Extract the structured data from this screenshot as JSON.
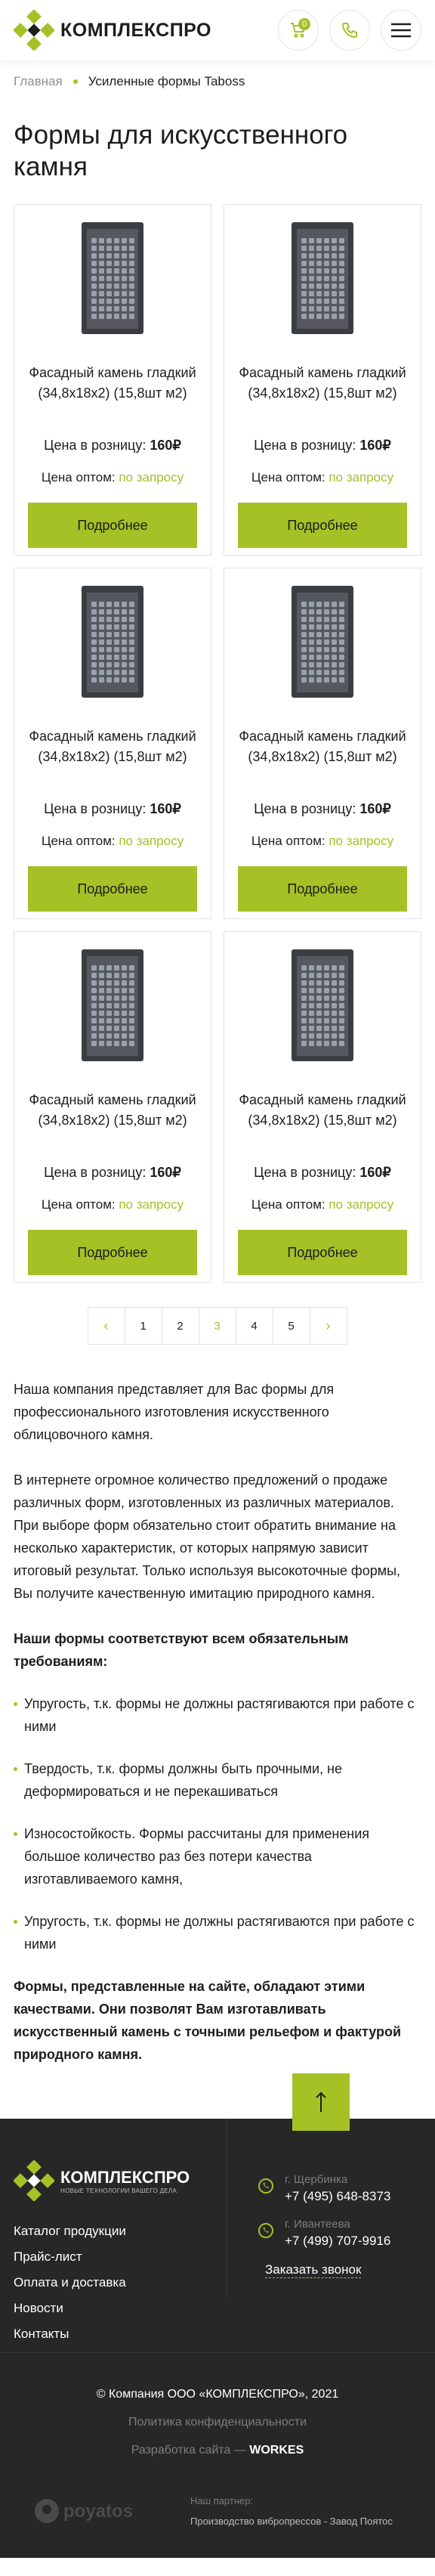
{
  "header": {
    "logo_text_a": "КОМПЛЕКС",
    "logo_text_b": "ПРО",
    "cart_count": "0",
    "icons": [
      "cart-icon",
      "phone-icon",
      "menu-icon"
    ]
  },
  "breadcrumbs": {
    "home": "Главная",
    "current": "Усиленные формы Taboss"
  },
  "page_title": "Формы для искусственного камня",
  "products": [
    {
      "name": "Фасадный камень гладкий (34,8х18х2) (15,8шт м2)",
      "retail_label": "Цена в розницу:",
      "retail_price": "160₽",
      "opt_label": "Цена оптом:",
      "opt_value": "по запросу",
      "button": "Подробнее"
    },
    {
      "name": "Фасадный камень гладкий (34,8х18х2) (15,8шт м2)",
      "retail_label": "Цена в розницу:",
      "retail_price": "160₽",
      "opt_label": "Цена оптом:",
      "opt_value": "по запросу",
      "button": "Подробнее"
    },
    {
      "name": "Фасадный камень гладкий (34,8х18х2) (15,8шт м2)",
      "retail_label": "Цена в розницу:",
      "retail_price": "160₽",
      "opt_label": "Цена оптом:",
      "opt_value": "по запросу",
      "button": "Подробнее"
    },
    {
      "name": "Фасадный камень гладкий (34,8х18х2) (15,8шт м2)",
      "retail_label": "Цена в розницу:",
      "retail_price": "160₽",
      "opt_label": "Цена оптом:",
      "opt_value": "по запросу",
      "button": "Подробнее"
    },
    {
      "name": "Фасадный камень гладкий (34,8х18х2) (15,8шт м2)",
      "retail_label": "Цена в розницу:",
      "retail_price": "160₽",
      "opt_label": "Цена оптом:",
      "opt_value": "по запросу",
      "button": "Подробнее"
    },
    {
      "name": "Фасадный камень гладкий (34,8х18х2) (15,8шт м2)",
      "retail_label": "Цена в розницу:",
      "retail_price": "160₽",
      "opt_label": "Цена оптом:",
      "opt_value": "по запросу",
      "button": "Подробнее"
    }
  ],
  "pagination": {
    "prev": "‹",
    "pages": [
      "1",
      "2",
      "3",
      "4",
      "5"
    ],
    "active": "3",
    "next": "›"
  },
  "content": {
    "p1": "Наша компания представляет для Вас формы для профессионального изготовления искусственного облицовочного камня.",
    "p2": "В интернете огромное количество предложений о продаже различных форм, изготовленных из различных материалов. При выборе форм обязательно стоит обратить внимание на несколько характеристик, от которых напрямую зависит итоговый результат. Только используя высокоточные формы, Вы получите качественную имитацию природного камня.",
    "req_title": "Наши формы соответствуют всем обязательным требованиям:",
    "list": [
      "Упругость, т.к. формы не должны растягиваются при работе с ними",
      "Твердость, т.к. формы должны быть прочными, не деформироваться и не перекашиваться",
      "Износостойкость. Формы рассчитаны для применения большое количество раз без потери качества изготавливаемого камня,",
      "Упругость, т.к. формы не должны растягиваются при работе с ними"
    ],
    "final": "Формы, представленные на сайте, обладают этими качествами. Они позволят Вам изготавливать искусственный камень с точными рельефом и фактурой природного камня."
  },
  "footer": {
    "logo_title": "КОМПЛЕКСПРО",
    "logo_sub": "НОВЫЕ ТЕХНОЛОГИИ ВАШЕГО ДЕЛА",
    "menu": [
      "Каталог продукции",
      "Прайс-лист",
      "Оплата и доставка",
      "Новости",
      "Контакты"
    ],
    "phones": [
      {
        "city": "г. Щербинка",
        "number": "+7 (495) 648-8373"
      },
      {
        "city": "г. Ивантеева",
        "number": "+7 (499) 707-9916"
      }
    ],
    "callback": "Заказать звонок",
    "copyright": "© Компания ООО «КОМПЛЕКСПРО», 2021",
    "privacy": "Политика конфиденциальности",
    "dev_label": "Разработка сайта —",
    "dev_name": "WORKES",
    "partner_logo": "poyatos",
    "partner_title": "Наш партнер:",
    "partner_name": "Производство вибропрессов - Завод Поятос"
  },
  "colors": {
    "accent": "#a4c126",
    "footer_bg": "#272727"
  }
}
